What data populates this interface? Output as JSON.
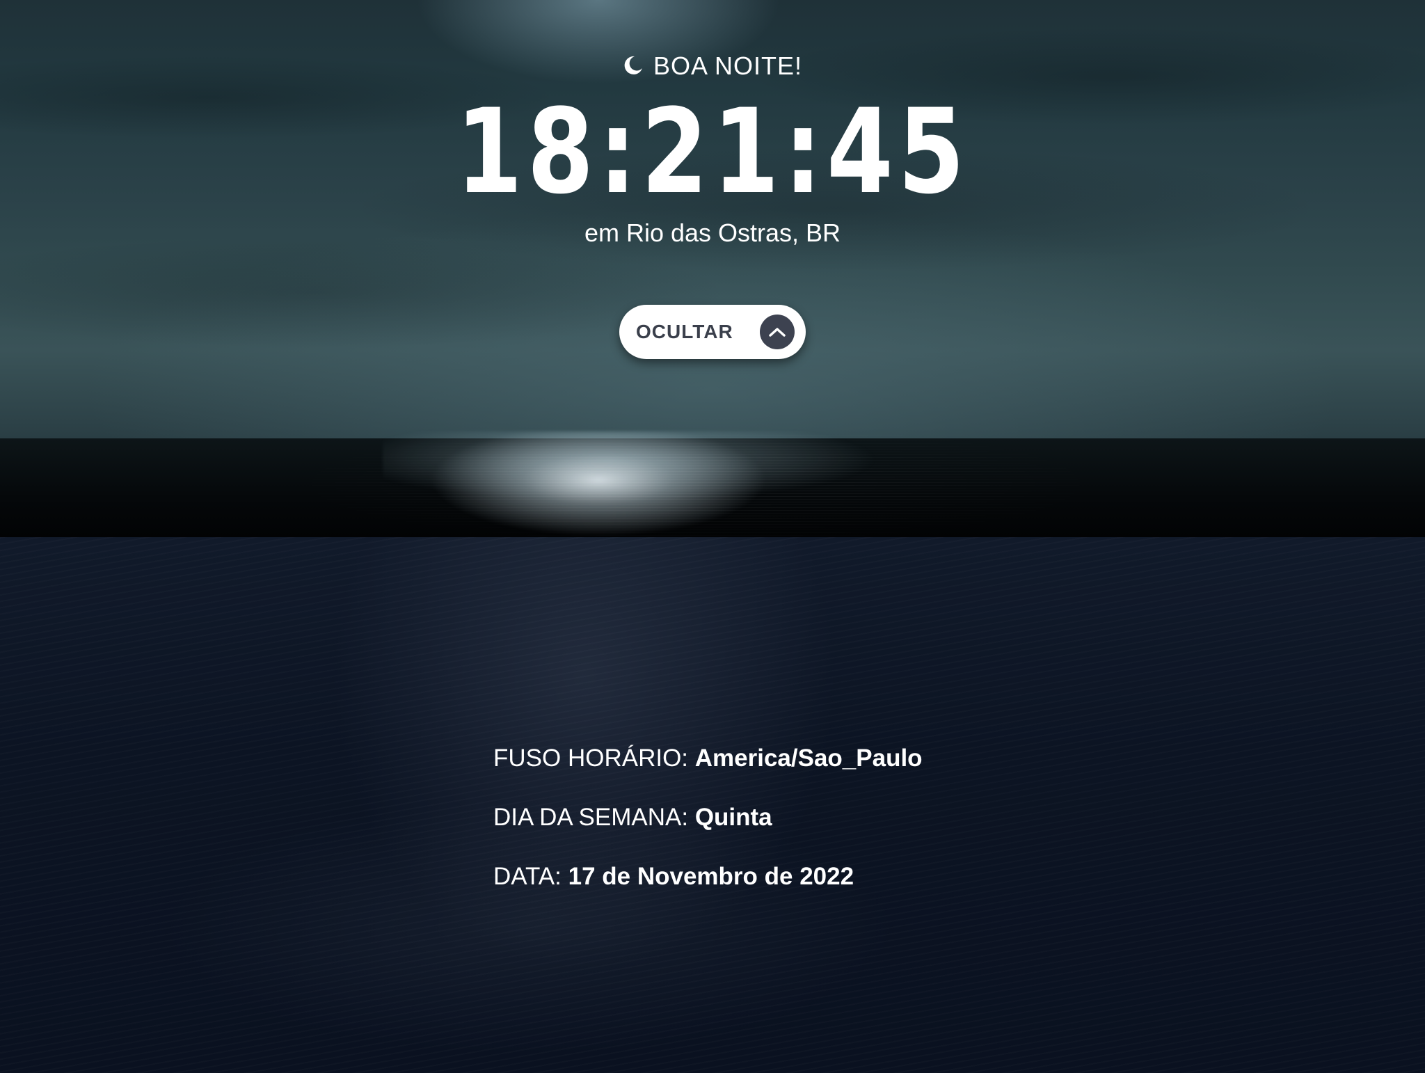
{
  "greeting": {
    "icon": "moon-icon",
    "text": "BOA NOITE!"
  },
  "clock": {
    "time": "18:21:45"
  },
  "location": {
    "text": "em Rio das Ostras, BR"
  },
  "toggle": {
    "label": "OCULTAR",
    "icon": "chevron-up-icon"
  },
  "details": [
    {
      "label": "FUSO HORÁRIO: ",
      "value": "America/Sao_Paulo"
    },
    {
      "label": "DIA DA SEMANA: ",
      "value": "Quinta"
    },
    {
      "label": "DATA: ",
      "value": "17 de Novembro de 2022"
    }
  ],
  "colors": {
    "panel_bg": "#0a1220",
    "button_bg": "#ffffff",
    "button_text": "#3a3f4b",
    "button_icon_bg": "#3d4250",
    "text": "#ffffff"
  }
}
